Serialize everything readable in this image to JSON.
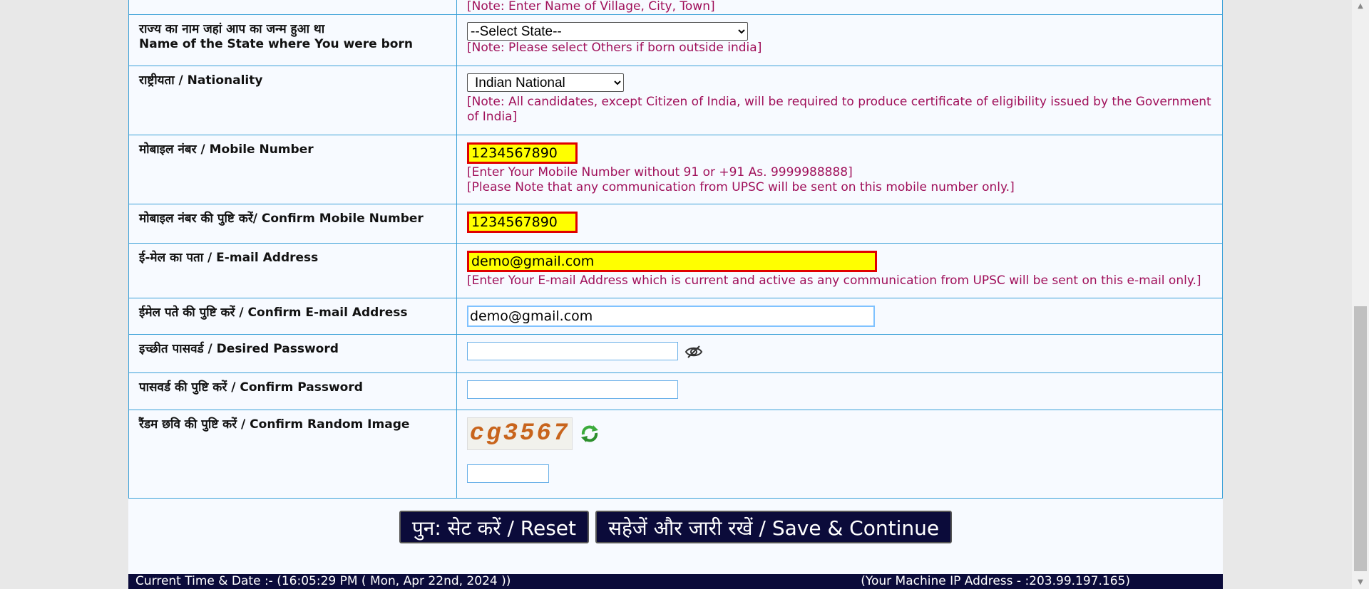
{
  "form": {
    "top_note_partial": "[Note: Enter Name of Village, City, Town]",
    "rows": {
      "state": {
        "label_hi": "राज्य का नाम जहां आप का जन्म हुआ था",
        "label_en": "Name of the State where You were born",
        "select_value": "--Select State--",
        "note": "[Note: Please select Others if born outside india]"
      },
      "nationality": {
        "label": "राष्ट्रीयता / Nationality",
        "select_value": "Indian National",
        "note": "[Note: All candidates, except Citizen of India, will be required to produce certificate of eligibility issued by the Government of India]"
      },
      "mobile": {
        "label": "मोबाइल नंबर / Mobile Number",
        "value": "1234567890",
        "note1": "[Enter Your Mobile Number without 91 or +91 As. 9999988888]",
        "note2": "[Please Note that any communication from UPSC will be sent on this mobile number only.]"
      },
      "confirm_mobile": {
        "label": "मोबाइल नंबर की पुष्टि करें/ Confirm Mobile Number",
        "value": "1234567890"
      },
      "email": {
        "label": "ई-मेल का पता / E-mail Address",
        "value": "demo@gmail.com",
        "note": "[Enter Your E-mail Address which is current and active as any communication from UPSC will be sent on this e-mail only.]"
      },
      "confirm_email": {
        "label": "ईमेल पते की पुष्टि करें / Confirm E-mail Address",
        "value": "demo@gmail.com"
      },
      "password": {
        "label": "इच्छीत पासवर्ड / Desired Password",
        "value": "",
        "icon": "eye-slash-icon"
      },
      "confirm_password": {
        "label": "पासवर्ड की पुष्टि करें / Confirm Password",
        "value": ""
      },
      "captcha": {
        "label": "रैंडम छवि की पुष्टि करें / Confirm Random Image",
        "image_text": "cg3567",
        "icon": "refresh-icon",
        "value": ""
      }
    }
  },
  "buttons": {
    "reset": "पुन: सेट करें / Reset",
    "save": "सहेजें और जारी रखें / Save & Continue"
  },
  "footer": {
    "time": "Current Time & Date :- (16:05:29 PM ( Mon, Apr 22nd, 2024 ))",
    "ip": "(Your Machine IP  Address - :203.99.197.165)"
  },
  "colors": {
    "required_bg": "#ffff00",
    "required_border": "#e00000",
    "note_text": "#a0105a",
    "button_bg": "#0b0b3a",
    "border": "#3aa0d8"
  }
}
